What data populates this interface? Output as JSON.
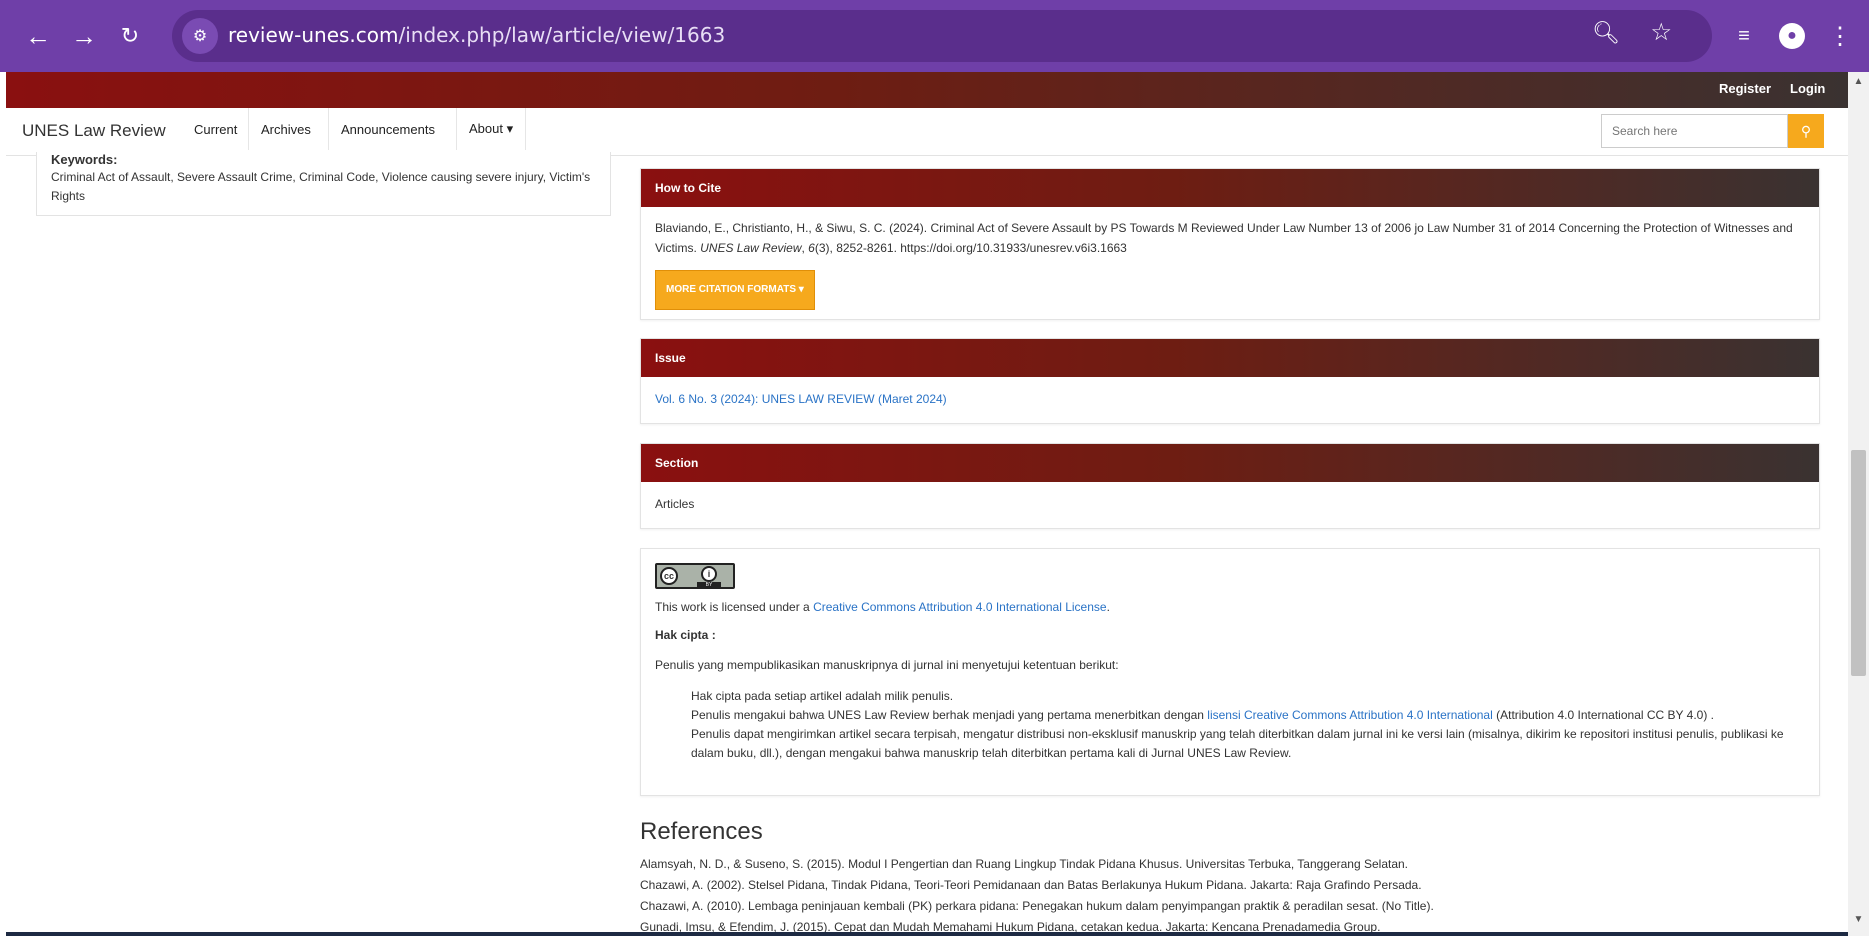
{
  "browser": {
    "url_domain": "review-unes.com",
    "url_path": "/index.php/law/article/view/1663"
  },
  "site": {
    "register": "Register",
    "login": "Login",
    "brand": "UNES Law Review",
    "nav": [
      "Current",
      "Archives",
      "Announcements",
      "About ▾"
    ],
    "search_placeholder": "Search here"
  },
  "keywords": {
    "label": "Keywords:",
    "text": "Criminal Act of Assault, Severe Assault Crime, Criminal Code, Violence causing severe injury, Victim's Rights"
  },
  "cite": {
    "heading": "How to Cite",
    "text_pre": "Blaviando, E., Christianto, H., & Siwu, S. C. (2024). Criminal Act of Severe Assault by PS Towards M Reviewed Under Law Number 13 of 2006 jo Law Number 31 of 2014 Concerning the Protection of Witnesses and Victims. ",
    "journal": "UNES Law Review",
    "vol": "6",
    "text_post": "(3), 8252-8261. https://doi.org/10.31933/unesrev.v6i3.1663",
    "more_button": "MORE CITATION FORMATS ▾"
  },
  "issue": {
    "heading": "Issue",
    "link": "Vol. 6 No. 3 (2024): UNES LAW REVIEW (Maret 2024)"
  },
  "section": {
    "heading": "Section",
    "value": "Articles"
  },
  "license": {
    "cc_badge": "cc",
    "by_label": "BY",
    "text_pre": "This work is licensed under a ",
    "link": "Creative Commons Attribution 4.0 International License",
    "text_post": ".",
    "copyright_title": "Hak cipta :",
    "intro": "Penulis yang mempublikasikan manuskripnya di jurnal ini menyetujui ketentuan berikut:",
    "item1": "Hak cipta pada setiap artikel adalah milik penulis.",
    "item2_pre": "Penulis mengakui bahwa UNES Law Review berhak menjadi yang pertama menerbitkan dengan ",
    "item2_link": "lisensi Creative Commons Attribution 4.0 International",
    "item2_post": " (Attribution 4.0 International CC BY 4.0) .",
    "item3": "Penulis dapat mengirimkan artikel secara terpisah, mengatur distribusi non-eksklusif manuskrip yang telah diterbitkan dalam jurnal ini ke versi lain (misalnya, dikirim ke repositori institusi penulis, publikasi ke dalam buku, dll.), dengan mengakui bahwa manuskrip telah diterbitkan pertama kali di Jurnal UNES Law Review."
  },
  "references": {
    "title": "References",
    "items": [
      "Alamsyah, N. D., & Suseno, S. (2015). Modul I Pengertian dan Ruang Lingkup Tindak Pidana Khusus. Universitas Terbuka, Tanggerang Selatan.",
      "Chazawi, A. (2002). Stelsel Pidana, Tindak Pidana, Teori-Teori Pemidanaan dan Batas Berlakunya Hukum Pidana. Jakarta: Raja Grafindo Persada.",
      "Chazawi, A. (2010). Lembaga peninjauan kembali (PK) perkara pidana: Penegakan hukum dalam penyimpangan praktik & peradilan sesat. (No Title).",
      "Gunadi, Imsu, & Efendim, J. (2015). Cepat dan Mudah Memahami Hukum Pidana, cetakan kedua. Jakarta: Kencana Prenadamedia Group."
    ]
  }
}
